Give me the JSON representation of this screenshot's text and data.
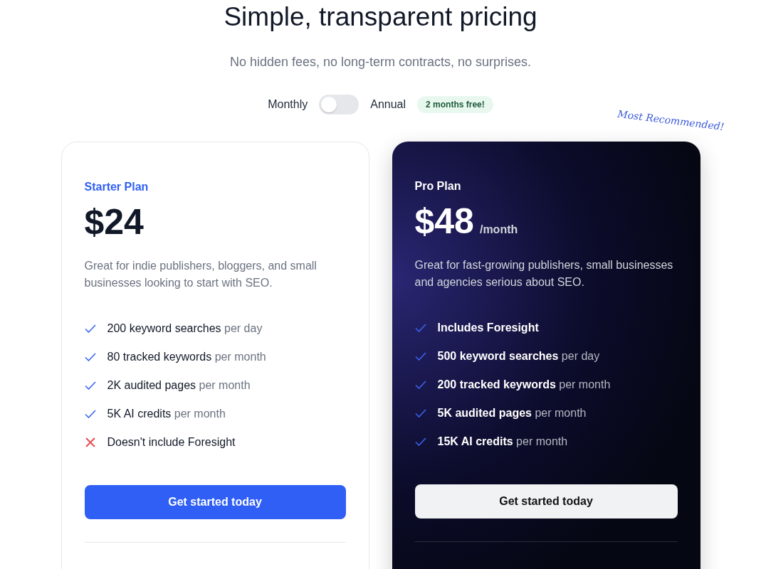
{
  "header": {
    "title": "Simple, transparent pricing",
    "subtitle": "No hidden fees, no long-term contracts, no surprises."
  },
  "billing": {
    "monthly_label": "Monthly",
    "annual_label": "Annual",
    "on": false,
    "badge": "2 months free!"
  },
  "recommendation_note": "Most Recommended!",
  "plans": [
    {
      "kind": "light",
      "name": "Starter Plan",
      "price": "$24",
      "description": "Great for indie publishers, bloggers, and small businesses looking to start with SEO.",
      "features": [
        {
          "kind": "included",
          "main": "200 keyword searches",
          "suffix": "per day"
        },
        {
          "kind": "included",
          "main": "80 tracked keywords",
          "suffix": "per month"
        },
        {
          "kind": "included",
          "main": "2K audited pages",
          "suffix": "per month"
        },
        {
          "kind": "included",
          "main": "5K AI credits",
          "suffix": "per month"
        },
        {
          "kind": "excluded",
          "main": "Doesn't include Foresight"
        }
      ],
      "button": "Get started today"
    },
    {
      "kind": "dark",
      "name": "Pro Plan",
      "price": "$48",
      "period": "/month",
      "description": "Great for fast-growing publishers, small businesses and agencies serious about SEO.",
      "features": [
        {
          "kind": "included",
          "main": "Includes Foresight"
        },
        {
          "kind": "included",
          "main": "500 keyword searches",
          "suffix": "per day"
        },
        {
          "kind": "included",
          "main": "200 tracked keywords",
          "suffix": "per month"
        },
        {
          "kind": "included",
          "main": "5K audited pages",
          "suffix": "per month"
        },
        {
          "kind": "included",
          "main": "15K AI credits",
          "suffix": "per month"
        }
      ],
      "button": "Get started today"
    }
  ]
}
